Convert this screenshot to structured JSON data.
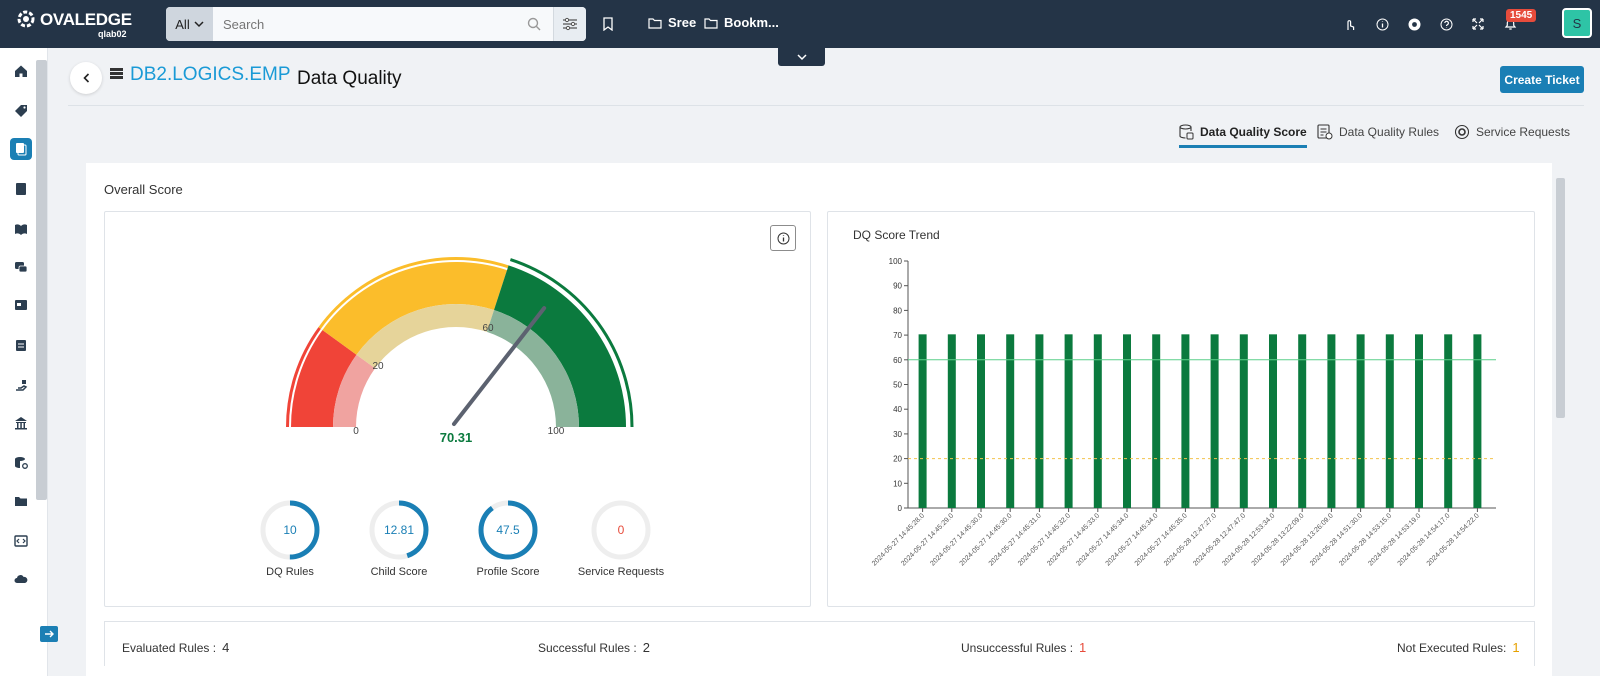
{
  "app": {
    "brand": "OVALEDGE",
    "instance": "qlab02"
  },
  "search": {
    "scope": "All",
    "placeholder": "Search"
  },
  "topbar": {
    "folder1": "Sree",
    "folder2": "Bookm...",
    "notification_count": "1545",
    "user_initial": "S"
  },
  "header": {
    "entity": "DB2.LOGICS.EMP",
    "title": "Data Quality",
    "create_ticket": "Create Ticket"
  },
  "tabs": [
    {
      "label": "Data Quality Score",
      "active": true
    },
    {
      "label": "Data Quality Rules",
      "active": false
    },
    {
      "label": "Service Requests",
      "active": false
    }
  ],
  "overall": {
    "title": "Overall Score"
  },
  "gauge": {
    "value": "70.31",
    "value_num": 70.31,
    "ticks": [
      "0",
      "20",
      "60",
      "100"
    ],
    "colors": {
      "red": "#f04438",
      "yellow": "#fbbd2b",
      "green": "#0b7a3e"
    }
  },
  "metrics": [
    {
      "value": "10",
      "label": "DQ Rules",
      "fraction": 0.5,
      "color": "#1a7fb5"
    },
    {
      "value": "12.81",
      "label": "Child Score",
      "fraction": 0.45,
      "color": "#1a7fb5"
    },
    {
      "value": "47.5",
      "label": "Profile Score",
      "fraction": 0.9,
      "color": "#1a7fb5"
    },
    {
      "value": "0",
      "label": "Service Requests",
      "fraction": 0,
      "color": "#e74c3c"
    }
  ],
  "chart_data": {
    "type": "bar",
    "title": "DQ Score Trend",
    "ylim": [
      0,
      100
    ],
    "yticks": [
      0,
      10,
      20,
      30,
      40,
      50,
      60,
      70,
      80,
      90,
      100
    ],
    "thresholds": [
      {
        "value": 60,
        "color": "#5ccf8a"
      },
      {
        "value": 20,
        "color": "#f3c24c"
      }
    ],
    "color": "#0b7a3e",
    "categories": [
      "2024-05-27 14:45:28.0",
      "2024-05-27 14:45:29.0",
      "2024-05-27 14:45:30.0",
      "2024-05-27 14:45:30.0",
      "2024-05-27 14:45:31.0",
      "2024-05-27 14:45:32.0",
      "2024-05-27 14:45:33.0",
      "2024-05-27 14:45:34.0",
      "2024-05-27 14:45:34.0",
      "2024-05-27 14:45:35.0",
      "2024-05-28 12:47:27.0",
      "2024-05-28 12:47:47.0",
      "2024-05-28 12:53:34.0",
      "2024-05-28 13:22:09.0",
      "2024-05-28 13:26:09.0",
      "2024-05-28 14:51:30.0",
      "2024-05-28 14:53:15.0",
      "2024-05-28 14:53:19.0",
      "2024-05-28 14:54:17.0",
      "2024-05-28 14:54:22.0"
    ],
    "values": [
      70.31,
      70.31,
      70.31,
      70.31,
      70.31,
      70.31,
      70.31,
      70.31,
      70.31,
      70.31,
      70.31,
      70.31,
      70.31,
      70.31,
      70.31,
      70.31,
      70.31,
      70.31,
      70.31,
      70.31
    ]
  },
  "stats": [
    {
      "label": "Evaluated Rules :",
      "value": "4",
      "color": "#333"
    },
    {
      "label": "Successful Rules :",
      "value": "2",
      "color": "#333"
    },
    {
      "label": "Unsuccessful Rules :",
      "value": "1",
      "color": "#e74c3c"
    },
    {
      "label": "Not Executed Rules:",
      "value": "1",
      "color": "#e6a100"
    }
  ]
}
